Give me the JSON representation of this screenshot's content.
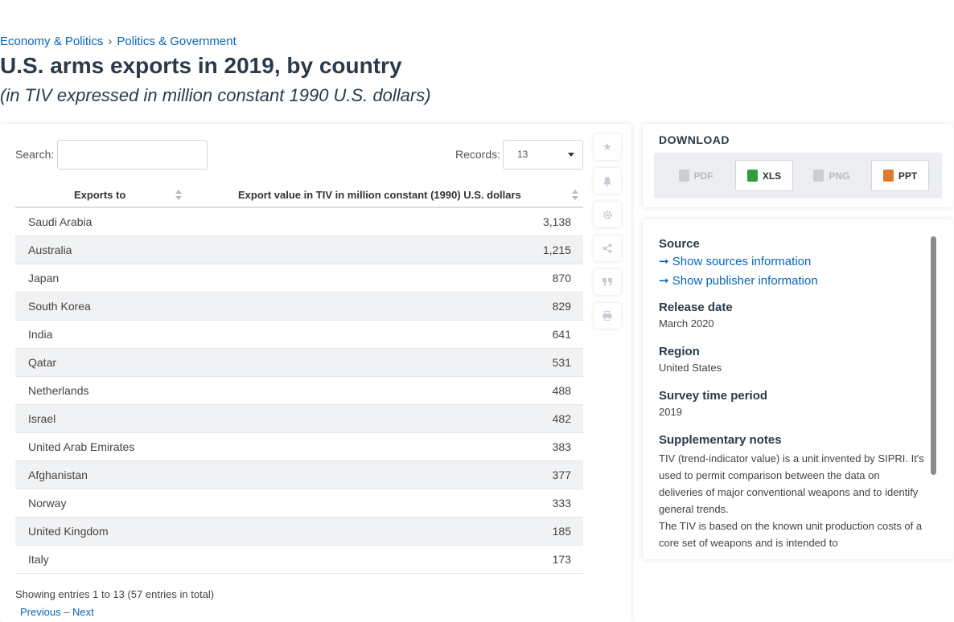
{
  "breadcrumb": {
    "item1": "Economy & Politics",
    "separator": "›",
    "item2": "Politics & Government"
  },
  "title": "U.S. arms exports in 2019, by country",
  "subtitle": "(in TIV expressed in million constant 1990 U.S. dollars)",
  "search": {
    "label": "Search:",
    "value": ""
  },
  "records": {
    "label": "Records:",
    "value": "13"
  },
  "table": {
    "headers": [
      "Exports to",
      "Export value in TIV in million constant (1990) U.S. dollars"
    ],
    "rows": [
      [
        "Saudi Arabia",
        "3,138"
      ],
      [
        "Australia",
        "1,215"
      ],
      [
        "Japan",
        "870"
      ],
      [
        "South Korea",
        "829"
      ],
      [
        "India",
        "641"
      ],
      [
        "Qatar",
        "531"
      ],
      [
        "Netherlands",
        "488"
      ],
      [
        "Israel",
        "482"
      ],
      [
        "United Arab Emirates",
        "383"
      ],
      [
        "Afghanistan",
        "377"
      ],
      [
        "Norway",
        "333"
      ],
      [
        "United Kingdom",
        "185"
      ],
      [
        "Italy",
        "173"
      ]
    ]
  },
  "entries_info": "Showing entries 1 to 13 (57 entries in total)",
  "pager": {
    "previous": "Previous",
    "next": "Next"
  },
  "tools": [
    "star-icon",
    "bell-icon",
    "gear-icon",
    "share-icon",
    "quote-icon",
    "print-icon"
  ],
  "download": {
    "title": "DOWNLOAD",
    "buttons": [
      {
        "label": "PDF",
        "enabled": false
      },
      {
        "label": "XLS",
        "enabled": true,
        "color": "#2e9e3e"
      },
      {
        "label": "PNG",
        "enabled": false
      },
      {
        "label": "PPT",
        "enabled": true,
        "color": "#e07a2f"
      }
    ]
  },
  "meta": {
    "source_heading": "Source",
    "show_sources": "Show sources information",
    "show_publisher": "Show publisher information",
    "release_heading": "Release date",
    "release_value": "March 2020",
    "region_heading": "Region",
    "region_value": "United States",
    "survey_heading": "Survey time period",
    "survey_value": "2019",
    "notes_heading": "Supplementary notes",
    "notes_p1": "TIV (trend-indicator value) is a unit invented by SIPRI. It's used to permit comparison between the data on deliveries of major conventional weapons and to identify general trends.",
    "notes_p2": "The TIV is based on the known unit production costs of a core set of weapons and is intended to"
  },
  "colors": {
    "link": "#0666b9",
    "title": "#2b3a4a",
    "stripe": "#f1f2f4"
  }
}
